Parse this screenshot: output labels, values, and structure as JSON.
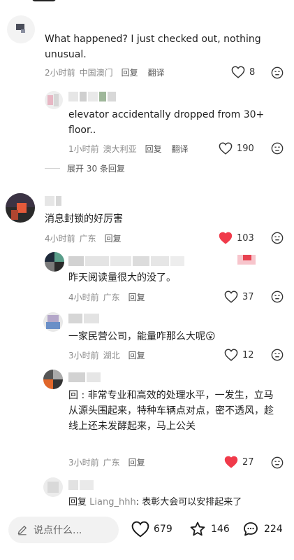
{
  "comments": [
    {
      "text": "What happened? I just checked out, nothing unusual.",
      "time": "2小时前",
      "location": "中国澳门",
      "reply_label": "回复",
      "translate_label": "翻译",
      "likes": "8",
      "liked": false
    },
    {
      "text": "elevator accidentally dropped from 30+ floor..",
      "time": "1小时前",
      "location": "澳大利亚",
      "reply_label": "回复",
      "translate_label": "翻译",
      "likes": "190",
      "liked": false
    },
    {
      "text": "消息封锁的好厉害",
      "time": "4小时前",
      "location": "广东",
      "reply_label": "回复",
      "likes": "103",
      "liked": true
    },
    {
      "text": "昨天阅读量很大的没了。",
      "time": "4小时前",
      "location": "广东",
      "reply_label": "回复",
      "likes": "37",
      "liked": false
    },
    {
      "text": "一家民营公司，能量咋那么大呢",
      "emoji": "😮",
      "time": "3小时前",
      "location": "湖北",
      "reply_label": "回复",
      "likes": "12",
      "liked": false
    },
    {
      "text": "回 : 非常专业和高效的处理水平，一发生，立马从源头围起来，特种车辆点对点，密不透风，趁线上还未发酵起来，马上公关",
      "time": "3小时前",
      "location": "广东",
      "reply_label": "回复",
      "likes": "27",
      "liked": true
    },
    {
      "reply_prefix": "回复",
      "reply_to": "Liang_hhh",
      "text": ": 表彰大会可以安排起来了"
    }
  ],
  "expand_replies": "展开 30 条回复",
  "bottom_bar": {
    "input_placeholder": "说点什么...",
    "likes": "679",
    "favorites": "146",
    "comments": "224"
  },
  "colors": {
    "like_red": "#f03a4a",
    "meta_gray": "#8a8a8a"
  }
}
